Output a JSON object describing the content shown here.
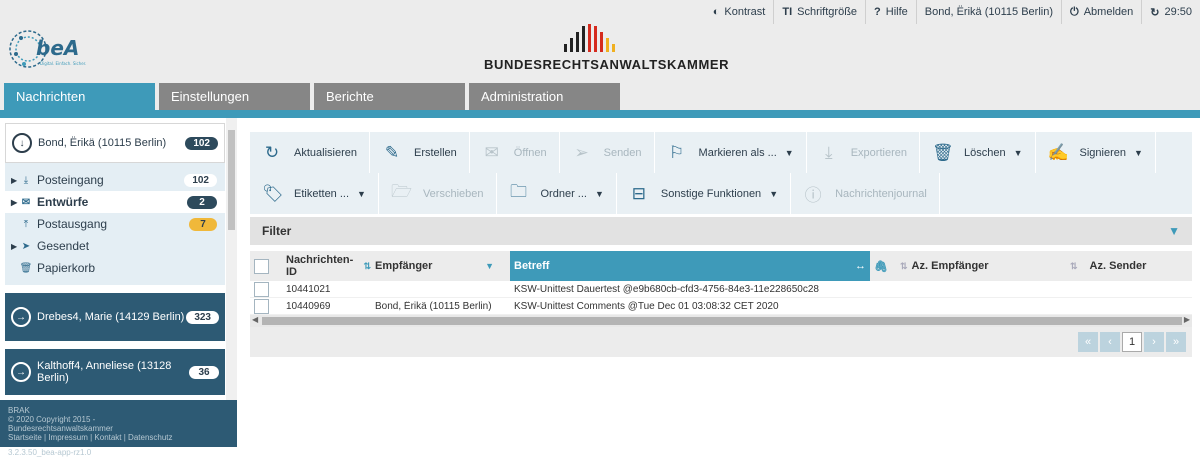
{
  "topbar": {
    "items": [
      {
        "icon": "contrast-icon",
        "label": "Kontrast"
      },
      {
        "icon": "font-size-icon",
        "label": "Schriftgröße"
      },
      {
        "icon": "help-icon",
        "label": "Hilfe"
      },
      {
        "icon": "user-icon",
        "label": "Bond, Ërikä (10115 Berlin)"
      },
      {
        "icon": "power-icon",
        "label": "Abmelden"
      },
      {
        "icon": "refresh-icon",
        "label": "29:50"
      }
    ]
  },
  "logo": {
    "bea": "beA",
    "bea_tagline": "Digital. Einfach. Sicher.",
    "brak": "BUNDESRECHTSANWALTSKAMMER"
  },
  "nav": {
    "tabs": [
      "Nachrichten",
      "Einstellungen",
      "Berichte",
      "Administration"
    ]
  },
  "sidebar": {
    "account": {
      "name": "Bond, Ërikä (10115 Berlin)",
      "count": "102"
    },
    "folders": [
      {
        "label": "Posteingang",
        "count": "102",
        "icon": "inbox-icon"
      },
      {
        "label": "Entwürfe",
        "count": "2",
        "icon": "envelope-icon"
      },
      {
        "label": "Postausgang",
        "count": "7",
        "icon": "outbox-icon"
      },
      {
        "label": "Gesendet",
        "count": "",
        "icon": "send-icon"
      },
      {
        "label": "Papierkorb",
        "count": "",
        "icon": "trash-icon"
      }
    ],
    "accounts": [
      {
        "name": "Drebes4, Marie (14129 Berlin)",
        "count": "323"
      },
      {
        "name": "Kalthoff4, Anneliese (13128 Berlin)",
        "count": "36"
      }
    ],
    "footer": {
      "brak": "BRAK",
      "copyright": "© 2020 Copyright 2015 -",
      "org": "Bundesrechtsanwaltskammer",
      "links": "Startseite | Impressum | Kontakt | Datenschutz",
      "version": "3.2.3.50_bea-app-rz1.0"
    }
  },
  "toolbar": {
    "row1": [
      {
        "label": "Aktualisieren",
        "icon": "refresh-icon",
        "disabled": false,
        "dropdown": false
      },
      {
        "label": "Erstellen",
        "icon": "pencil-icon",
        "disabled": false,
        "dropdown": false
      },
      {
        "label": "Öffnen",
        "icon": "envelope-open-icon",
        "disabled": true,
        "dropdown": false
      },
      {
        "label": "Senden",
        "icon": "paper-plane-icon",
        "disabled": true,
        "dropdown": false
      },
      {
        "label": "Markieren als ...",
        "icon": "bookmark-icon",
        "disabled": false,
        "dropdown": true
      },
      {
        "label": "Exportieren",
        "icon": "download-icon",
        "disabled": true,
        "dropdown": false
      },
      {
        "label": "Löschen",
        "icon": "trash-icon",
        "disabled": false,
        "dropdown": true
      },
      {
        "label": "Signieren",
        "icon": "edit-icon",
        "disabled": false,
        "dropdown": true
      }
    ],
    "row2": [
      {
        "label": "Etiketten ...",
        "icon": "tags-icon",
        "disabled": false,
        "dropdown": true
      },
      {
        "label": "Verschieben",
        "icon": "folder-open-icon",
        "disabled": true,
        "dropdown": false
      },
      {
        "label": "Ordner ...",
        "icon": "folder-icon",
        "disabled": false,
        "dropdown": true
      },
      {
        "label": "Sonstige Funktionen",
        "icon": "caret-square-icon",
        "disabled": false,
        "dropdown": true
      },
      {
        "label": "Nachrichtenjournal",
        "icon": "info-icon",
        "disabled": true,
        "dropdown": false
      }
    ]
  },
  "filter": {
    "label": "Filter"
  },
  "table": {
    "columns": [
      "Nachrichten-ID",
      "Empfänger",
      "Betreff",
      "Az. Empfänger",
      "Az. Sender"
    ],
    "rows": [
      {
        "id": "10441021",
        "empfaenger": "",
        "betreff": "KSW-Unittest Dauertest @e9b680cb-cfd3-4756-84e3-11e228650c28"
      },
      {
        "id": "10440969",
        "empfaenger": "Bond, Ërikä (10115 Berlin)",
        "betreff": "KSW-Unittest Comments @Tue Dec 01 03:08:32 CET 2020"
      }
    ]
  },
  "pager": {
    "page": "1"
  },
  "colors": {
    "accent": "#3e9ab9",
    "dark": "#2d5a74",
    "badge_yellow": "#f0b83a"
  }
}
